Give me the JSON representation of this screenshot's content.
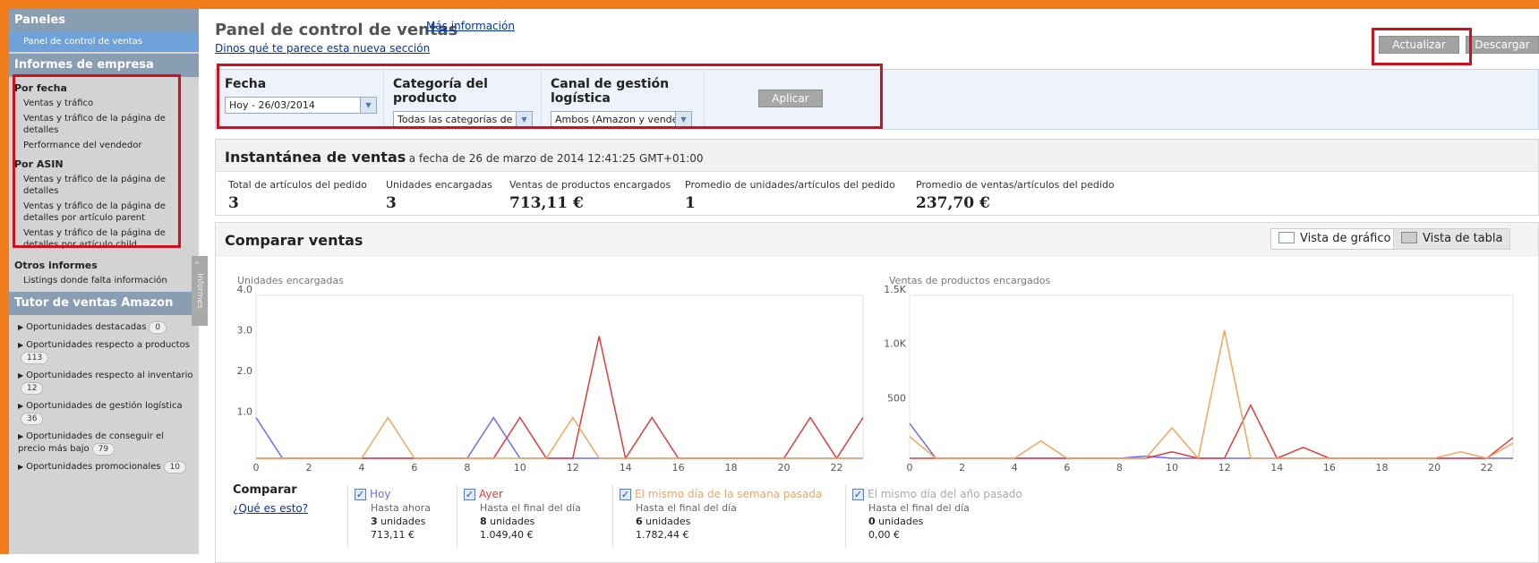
{
  "sidebar": {
    "paneles_head": "Paneles",
    "active_item": "Panel de control de ventas",
    "informes_head": "Informes de empresa",
    "por_fecha": "Por fecha",
    "fecha_items": [
      "Ventas y tráfico",
      "Ventas y tráfico de la página de detalles",
      "Performance del vendedor"
    ],
    "por_asin": "Por ASIN",
    "asin_items": [
      "Ventas y tráfico de la página de detalles",
      "Ventas y tráfico de la página de detalles por artículo parent",
      "Ventas y tráfico de la página de detalles por artículo child"
    ],
    "otros": "Otros informes",
    "otros_items": [
      "Listings donde falta información"
    ],
    "tutor_head": "Tutor de ventas Amazon",
    "opportunities": [
      {
        "label": "Oportunidades destacadas",
        "count": "0"
      },
      {
        "label": "Oportunidades respecto a productos",
        "count": "113"
      },
      {
        "label": "Oportunidades respecto al inventario",
        "count": "12"
      },
      {
        "label": "Oportunidades de gestión logística",
        "count": "36"
      },
      {
        "label": "Oportunidades de conseguir el precio más bajo",
        "count": "79"
      },
      {
        "label": "Oportunidades promocionales",
        "count": "10"
      }
    ],
    "informes_tab": "Informes"
  },
  "header": {
    "title": "Panel de control de ventas",
    "more_info": "Más información",
    "feedback": "Dinos qué te parece esta nueva sección",
    "refresh": "Actualizar",
    "download": "Descargar"
  },
  "filters": {
    "fecha_label": "Fecha",
    "fecha_value": "Hoy - 26/03/2014",
    "categoria_label": "Categoría del producto",
    "categoria_value": "Todas las categorías de pro",
    "canal_label": "Canal de gestión logística",
    "canal_value": "Ambos (Amazon y vended",
    "apply": "Aplicar"
  },
  "snapshot": {
    "title": "Instantánea de ventas",
    "subtitle": "a fecha de 26 de marzo de 2014 12:41:25 GMT+01:00",
    "metrics": [
      {
        "label": "Total de artículos del pedido",
        "value": "3"
      },
      {
        "label": "Unidades encargadas",
        "value": "3"
      },
      {
        "label": "Ventas de productos encargados",
        "value": "713,11 €"
      },
      {
        "label": "Promedio de unidades/artículos del pedido",
        "value": "1"
      },
      {
        "label": "Promedio de ventas/artículos del pedido",
        "value": "237,70 €"
      }
    ]
  },
  "compare": {
    "title": "Comparar ventas",
    "chart_view": "Vista de gráfico",
    "table_view": "Vista de tabla",
    "compare_label": "Comparar",
    "what_is": "¿Qué es esto?",
    "legend": [
      {
        "title": "Hoy",
        "line": "Hasta ahora",
        "units": "3",
        "units_word": "unidades",
        "amount": "713,11 €"
      },
      {
        "title": "Ayer",
        "line": "Hasta el final del día",
        "units": "8",
        "units_word": "unidades",
        "amount": "1.049,40 €"
      },
      {
        "title": "El mismo día de la semana pasada",
        "line": "Hasta el final del día",
        "units": "6",
        "units_word": "unidades",
        "amount": "1.782,44 €"
      },
      {
        "title": "El mismo día del año pasado",
        "line": "Hasta el final del día",
        "units": "0",
        "units_word": "unidades",
        "amount": "0,00 €"
      }
    ]
  },
  "colors": {
    "hoy": "#6a6aff",
    "ayer": "#e03c3c",
    "semana": "#f4a45a",
    "anio": "#aaaaaa"
  },
  "chart_data": [
    {
      "type": "line",
      "title": "Unidades encargadas",
      "x": [
        0,
        1,
        2,
        3,
        4,
        5,
        6,
        7,
        8,
        9,
        10,
        11,
        12,
        13,
        14,
        15,
        16,
        17,
        18,
        19,
        20,
        21,
        22,
        23
      ],
      "xticks": [
        "0",
        "2",
        "4",
        "6",
        "8",
        "10",
        "12",
        "14",
        "16",
        "18",
        "20",
        "22"
      ],
      "yticks": [
        "1.0",
        "2.0",
        "3.0",
        "4.0"
      ],
      "ylim": [
        0,
        4
      ],
      "series": [
        {
          "name": "Hoy",
          "values": [
            1,
            0,
            0,
            0,
            0,
            0,
            0,
            0,
            0,
            1,
            0,
            0,
            0,
            0,
            0,
            0,
            0,
            0,
            0,
            0,
            0,
            0,
            0,
            0
          ]
        },
        {
          "name": "Ayer",
          "values": [
            0,
            0,
            0,
            0,
            0,
            0,
            0,
            0,
            0,
            0,
            1,
            0,
            0,
            3,
            0,
            1,
            0,
            0,
            0,
            0,
            0,
            1,
            0,
            1
          ]
        },
        {
          "name": "El mismo día de la semana pasada",
          "values": [
            0,
            0,
            0,
            0,
            0,
            1,
            0,
            0,
            0,
            0,
            0,
            0,
            1,
            0,
            0,
            0,
            0,
            0,
            0,
            0,
            0,
            0,
            0,
            0
          ]
        }
      ]
    },
    {
      "type": "line",
      "title": "Ventas de productos encargados",
      "x": [
        0,
        1,
        2,
        3,
        4,
        5,
        6,
        7,
        8,
        9,
        10,
        11,
        12,
        13,
        14,
        15,
        16,
        17,
        18,
        19,
        20,
        21,
        22,
        23
      ],
      "xticks": [
        "0",
        "2",
        "4",
        "6",
        "8",
        "10",
        "12",
        "14",
        "16",
        "18",
        "20",
        "22"
      ],
      "yticks": [
        "500",
        "1.0K",
        "1.5K"
      ],
      "ylim": [
        0,
        1500
      ],
      "series": [
        {
          "name": "Hoy",
          "values": [
            320,
            0,
            0,
            0,
            0,
            0,
            0,
            0,
            0,
            20,
            0,
            0,
            0,
            0,
            0,
            0,
            0,
            0,
            0,
            0,
            0,
            0,
            0,
            0
          ]
        },
        {
          "name": "Ayer",
          "values": [
            0,
            0,
            0,
            0,
            0,
            0,
            0,
            0,
            0,
            0,
            60,
            0,
            0,
            490,
            0,
            100,
            0,
            0,
            0,
            0,
            0,
            0,
            0,
            190
          ]
        },
        {
          "name": "El mismo día de la semana pasada",
          "values": [
            200,
            0,
            0,
            0,
            0,
            160,
            0,
            0,
            0,
            0,
            280,
            0,
            1180,
            0,
            0,
            0,
            0,
            0,
            0,
            0,
            0,
            60,
            0,
            140
          ]
        }
      ]
    }
  ]
}
